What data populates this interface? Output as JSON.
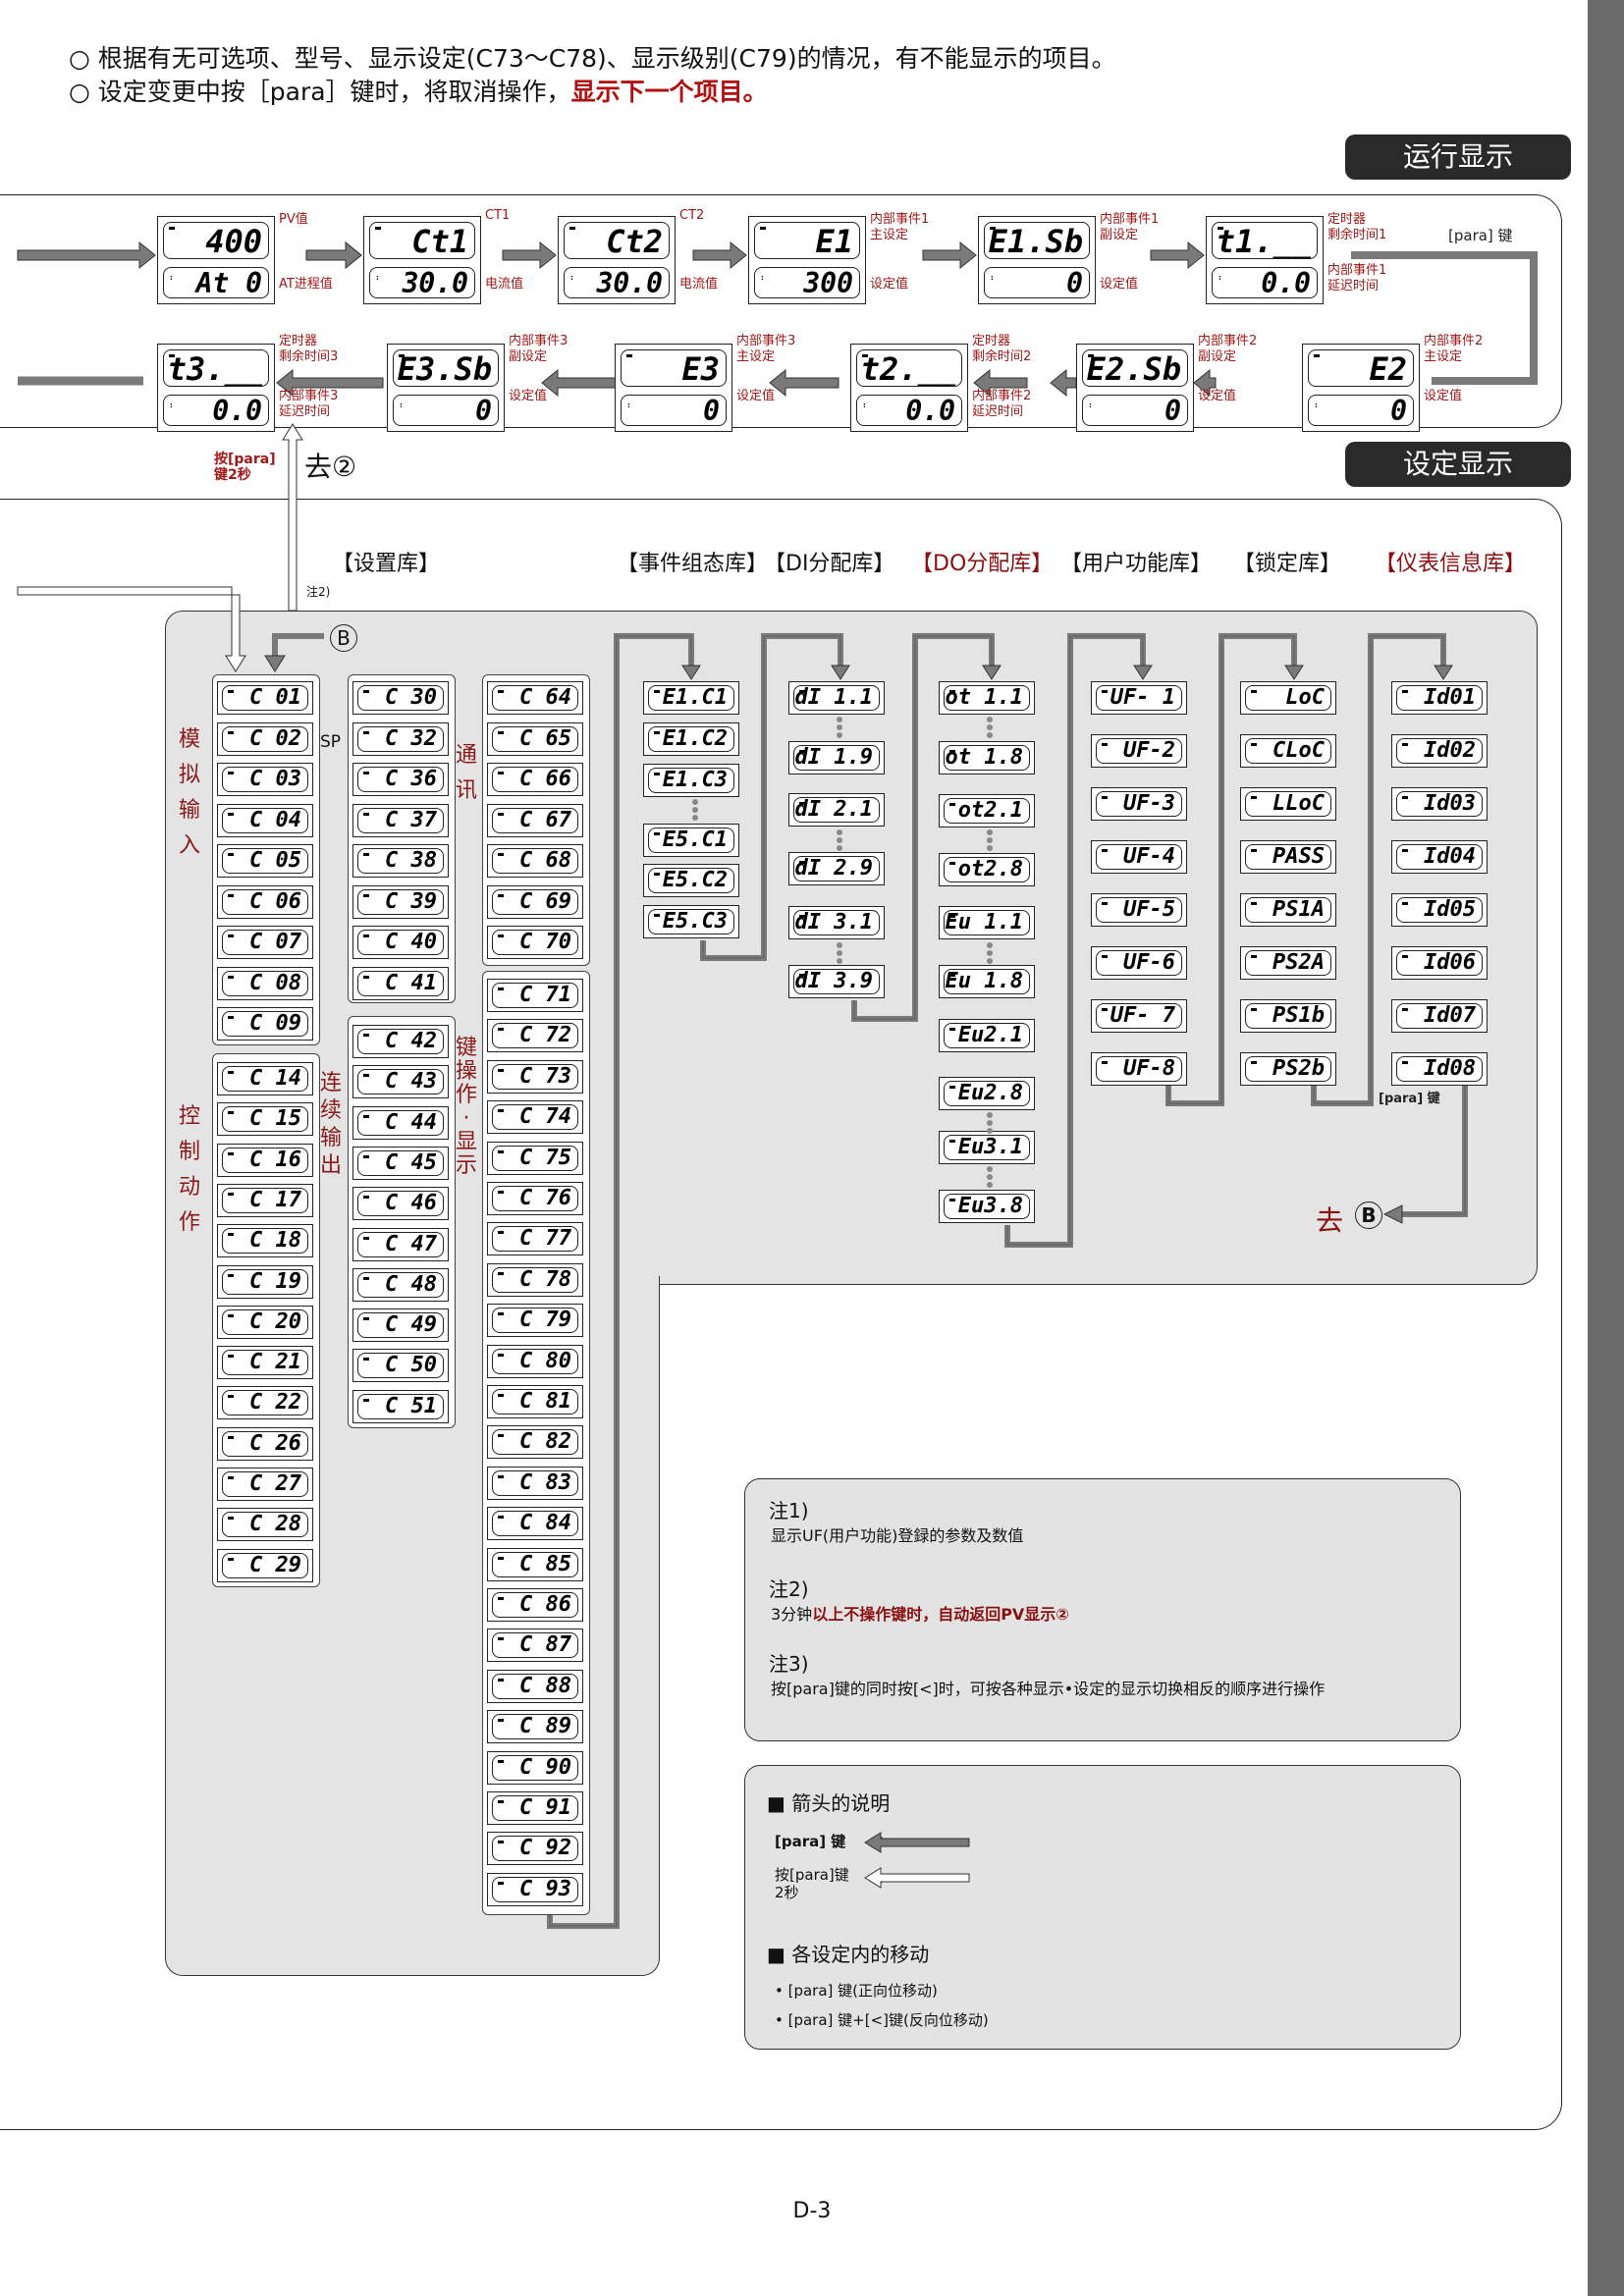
{
  "intro": {
    "line1": "○ 根据有无可选项、型号、显示设定(C73～C78)、显示级别(C79)的情况，有不能显示的项目。",
    "line2_prefix": "○ 设定变更中按［para］键时，将取消操作，",
    "line2_red": "显示下一个项目。"
  },
  "sections": {
    "run_display": "运行显示",
    "setting_display": "设定显示"
  },
  "run_row1": [
    {
      "top": "400",
      "bottom": "At 0",
      "label_top": "PV值",
      "label_bottom": "AT进程值"
    },
    {
      "top": "Ct1",
      "bottom": "30.0",
      "label_top": "CT1",
      "label_bottom": "电流值"
    },
    {
      "top": "Ct2",
      "bottom": "30.0",
      "label_top": "CT2",
      "label_bottom": "电流值"
    },
    {
      "top": "E1",
      "bottom": "300",
      "label_top": "内部事件1\n主设定",
      "label_bottom": "设定值"
    },
    {
      "top": "E1.Sb",
      "bottom": "0",
      "label_top": "内部事件1\n副设定",
      "label_bottom": "设定值"
    },
    {
      "top": "t1.__",
      "bottom": "0.0",
      "label_top": "定时器\n剩余时间1",
      "label_bottom": "内部事件1\n延迟时间"
    }
  ],
  "run_row2": [
    {
      "top": "t3.__",
      "bottom": "0.0",
      "label_top": "定时器\n剩余时间3",
      "label_bottom": "内部事件3\n延迟时间"
    },
    {
      "top": "E3.Sb",
      "bottom": "0",
      "label_top": "内部事件3\n副设定",
      "label_bottom": "设定值"
    },
    {
      "top": "E3",
      "bottom": "0",
      "label_top": "内部事件3\n主设定",
      "label_bottom": "设定值"
    },
    {
      "top": "t2.__",
      "bottom": "0.0",
      "label_top": "定时器\n剩余时间2",
      "label_bottom": "内部事件2\n延迟时间"
    },
    {
      "top": "E2.Sb",
      "bottom": "0",
      "label_top": "内部事件2\n副设定",
      "label_bottom": "设定值"
    },
    {
      "top": "E2",
      "bottom": "0",
      "label_top": "内部事件2\n主设定",
      "label_bottom": "设定值"
    }
  ],
  "run_para_key": "[para] 键",
  "press_para_2s": "按[para]\n键2秒",
  "goto_2": "去②",
  "note2_ref": "注2)",
  "marker_b": "B",
  "goto_b": "去",
  "para_key_small": "[para] 键",
  "banks": {
    "setup": "【设置库】",
    "event_config": "【事件组态库】",
    "di_assign": "【DI分配库】",
    "do_assign": "【DO分配库】",
    "user_function": "【用户功能库】",
    "lock": "【锁定库】",
    "instrument_info": "【仪表信息库】"
  },
  "group_labels": {
    "analog_input": "模拟输入",
    "control_action": "控制动作",
    "sp": "SP",
    "comm": "通讯",
    "continuous_output": "连续输出",
    "key_display": "键操作·显示"
  },
  "setup_col1_a": [
    "C 01",
    "C 02",
    "C 03",
    "C 04",
    "C 05",
    "C 06",
    "C 07",
    "C 08",
    "C 09"
  ],
  "setup_col1_b": [
    "C 14",
    "C 15",
    "C 16",
    "C 17",
    "C 18",
    "C 19",
    "C 20",
    "C 21",
    "C 22",
    "C 26",
    "C 27",
    "C 28",
    "C 29"
  ],
  "setup_col2_a": [
    "C 30",
    "C 32",
    "C 36",
    "C 37",
    "C 38",
    "C 39",
    "C 40",
    "C 41"
  ],
  "setup_col2_b": [
    "C 42",
    "C 43",
    "C 44",
    "C 45",
    "C 46",
    "C 47",
    "C 48",
    "C 49",
    "C 50",
    "C 51"
  ],
  "setup_col3_a": [
    "C 64",
    "C 65",
    "C 66",
    "C 67",
    "C 68",
    "C 69",
    "C 70"
  ],
  "setup_col3_b": [
    "C 71",
    "C 72",
    "C 73",
    "C 74",
    "C 75",
    "C 76",
    "C 77",
    "C 78",
    "C 79",
    "C 80",
    "C 81",
    "C 82",
    "C 83",
    "C 84",
    "C 85",
    "C 86",
    "C 87",
    "C 88",
    "C 89",
    "C 90",
    "C 91",
    "C 92",
    "C 93"
  ],
  "event_bank": [
    "E1.C1",
    "E1.C2",
    "E1.C3",
    "E5.C1",
    "E5.C2",
    "E5.C3"
  ],
  "di_bank": [
    "dI 1.1",
    "dI 1.9",
    "dI 2.1",
    "dI 2.9",
    "dI 3.1",
    "dI 3.9"
  ],
  "do_bank": [
    "ot 1.1",
    "ot 1.8",
    "ot2.1",
    "ot2.8",
    "Eu 1.1",
    "Eu 1.8",
    "Eu2.1",
    "Eu2.8",
    "Eu3.1",
    "Eu3.8"
  ],
  "uf_bank": [
    "UF- 1",
    "UF-2",
    "UF-3",
    "UF-4",
    "UF-5",
    "UF-6",
    "UF- 7",
    "UF-8"
  ],
  "lock_bank": [
    "LoC",
    "CLoC",
    "LLoC",
    "PASS",
    "PS1A",
    "PS2A",
    "PS1b",
    "PS2b"
  ],
  "id_bank": [
    "Id01",
    "Id02",
    "Id03",
    "Id04",
    "Id05",
    "Id06",
    "Id07",
    "Id08"
  ],
  "notes": {
    "n1_title": "注1)",
    "n1_text": "显示UF(用户功能)登録的参数及数值",
    "n2_title": "注2)",
    "n2_prefix": "3分钟",
    "n2_red": "以上不操作键时，自动返回PV显示②",
    "n3_title": "注3)",
    "n3_text": "按[para]键的同时按[<]时，可按各种显示•设定的显示切换相反的顺序进行操作"
  },
  "legend": {
    "arrows_title": "■ 箭头的说明",
    "para_key": "[para] 键",
    "colon": ":",
    "para_2s_line1": "按[para]键",
    "para_2s_line2": "2秒",
    "move_title": "■ 各设定内的移动",
    "move_fwd": "• [para] 键(正向位移动)",
    "move_rev": "• [para] 键+[<]键(反向位移动)"
  },
  "page_number": "D-3"
}
